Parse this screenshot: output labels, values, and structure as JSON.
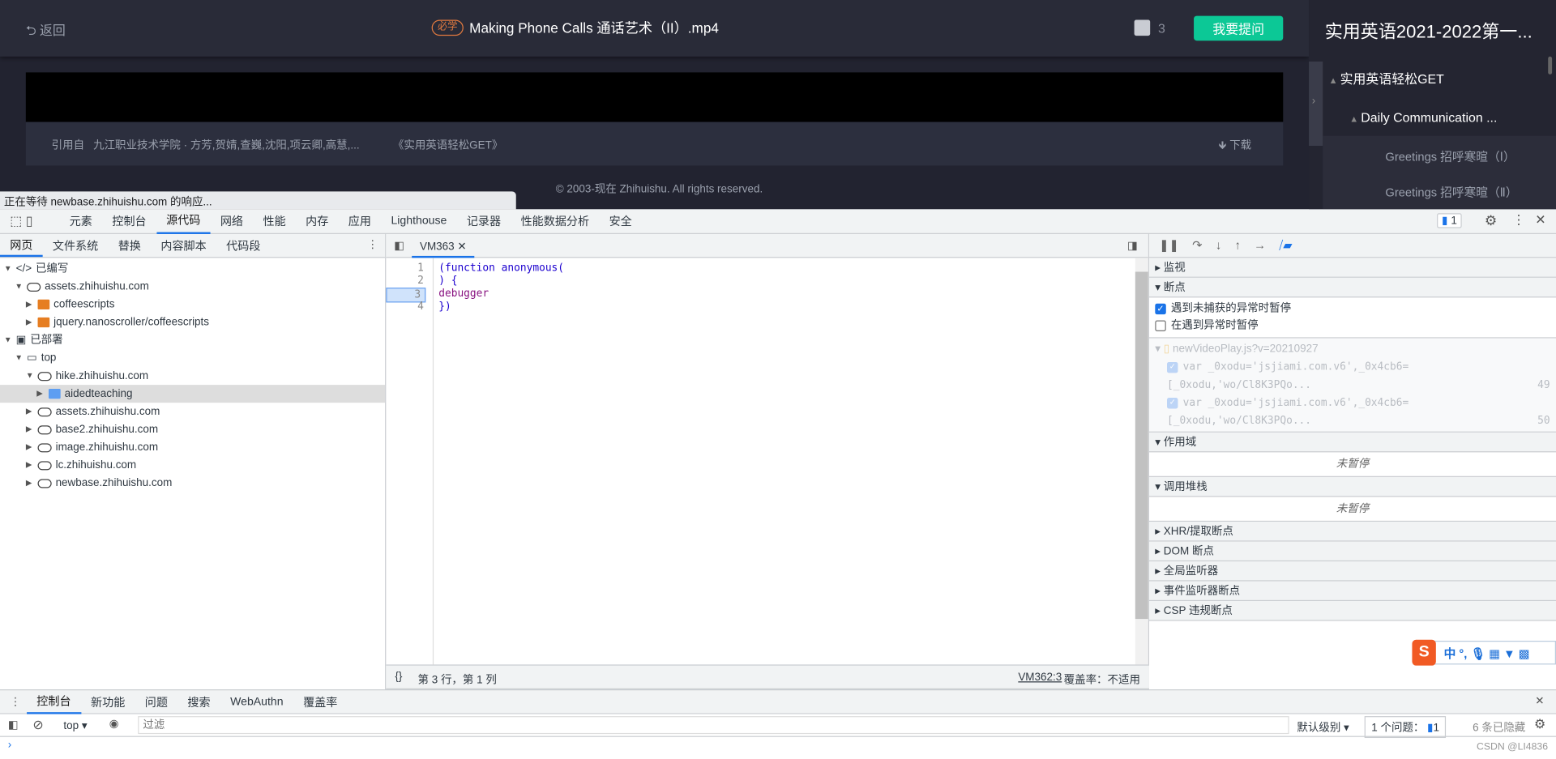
{
  "page": {
    "back": "返回",
    "badge": "必学",
    "title": "Making Phone Calls 通话艺术（II）.mp4",
    "comment_count": "3",
    "ask_button": "我要提问",
    "cite_label": "引用自",
    "cite_authors": "九江职业技术学院 · 方芳,贺婧,查巍,沈阳,项云卿,高慧,...",
    "cite_course": "《实用英语轻松GET》",
    "download": "下载",
    "copyright": "© 2003-现在 Zhihuishu. All rights reserved.",
    "status_tooltip": "正在等待 newbase.zhihuishu.com 的响应...",
    "sidebar": {
      "title": "实用英语2021-2022第一...",
      "items": [
        "实用英语轻松GET",
        "Daily Communication ...",
        "Greetings 招呼寒暄（Ⅰ）",
        "Greetings 招呼寒暄（Ⅱ）"
      ]
    },
    "accent": "#0cc896"
  },
  "devtools": {
    "tabs": [
      "元素",
      "控制台",
      "源代码",
      "网络",
      "性能",
      "内存",
      "应用",
      "Lighthouse",
      "记录器",
      "性能数据分析",
      "安全"
    ],
    "selected_tab": "源代码",
    "issues_count": "1",
    "nav_tabs": [
      "网页",
      "文件系统",
      "替换",
      "内容脚本",
      "代码段"
    ],
    "tree": [
      {
        "label": "已编写",
        "depth": 0
      },
      {
        "label": "assets.zhihuishu.com",
        "depth": 1
      },
      {
        "label": "coffeescripts",
        "depth": 2
      },
      {
        "label": "jquery.nanoscroller/coffeescripts",
        "depth": 2
      },
      {
        "label": "已部署",
        "depth": 0
      },
      {
        "label": "top",
        "depth": 1
      },
      {
        "label": "hike.zhihuishu.com",
        "depth": 2
      },
      {
        "label": "aidedteaching",
        "depth": 3
      },
      {
        "label": "assets.zhihuishu.com",
        "depth": 2
      },
      {
        "label": "base2.zhihuishu.com",
        "depth": 2
      },
      {
        "label": "image.zhihuishu.com",
        "depth": 2
      },
      {
        "label": "lc.zhihuishu.com",
        "depth": 2
      },
      {
        "label": "newbase.zhihuishu.com",
        "depth": 2
      }
    ],
    "editor_tab": "VM363",
    "code": [
      "(function anonymous(",
      ") {",
      "debugger",
      "})"
    ],
    "current_line": 3,
    "status_left": "第 3 行，第 1 列",
    "status_link": "VM362:3",
    "status_coverage": "覆盖率：不适用",
    "sections": {
      "watch": "监视",
      "breakpoints": "断点",
      "bp_uncaught": "遇到未捕获的异常时暂停",
      "bp_caught": "在遇到异常时暂停",
      "bp_file": "newVideoPlay.js?v=20210927",
      "bp_lines": [
        {
          "code": "var _0xodu='jsjiami.com.v6',_0x4cb6=[_0xodu,'wo/Cl8K3PQo...",
          "line": "49"
        },
        {
          "code": "var _0xodu='jsjiami.com.v6',_0x4cb6=[_0xodu,'wo/Cl8K3PQo...",
          "line": "50"
        }
      ],
      "scope": "作用域",
      "not_paused": "未暂停",
      "callstack": "调用堆栈",
      "xhr": "XHR/提取断点",
      "dom": "DOM 断点",
      "global": "全局监听器",
      "event": "事件监听器断点",
      "csp": "CSP 违规断点"
    },
    "drawer_tabs": [
      "控制台",
      "新功能",
      "问题",
      "搜索",
      "WebAuthn",
      "覆盖率"
    ],
    "console": {
      "context": "top",
      "filter_placeholder": "过滤",
      "level": "默认级别",
      "issues": "1 个问题：",
      "issues_count": "1",
      "hidden": "6 条已隐藏"
    },
    "watermark": "CSDN @LI4836",
    "ime": "中 °,"
  }
}
